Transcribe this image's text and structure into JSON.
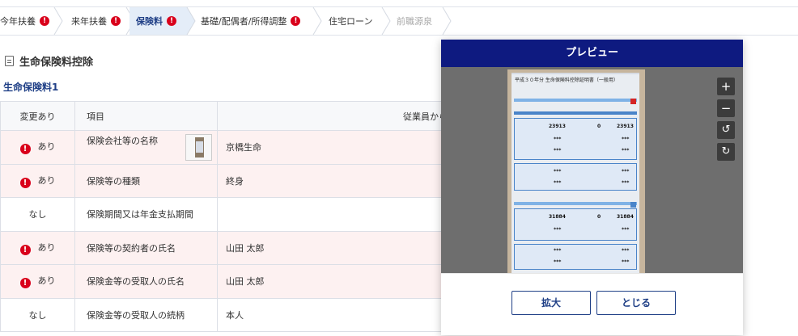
{
  "steps": [
    {
      "label": "今年扶養",
      "alert": "!",
      "state": "normal"
    },
    {
      "label": "来年扶養",
      "alert": "!",
      "state": "normal"
    },
    {
      "label": "保険料",
      "alert": "!",
      "state": "active"
    },
    {
      "label": "基礎/配偶者/所得調整",
      "alert": "!",
      "state": "normal"
    },
    {
      "label": "住宅ローン",
      "alert": "",
      "state": "normal"
    },
    {
      "label": "前職源泉",
      "alert": "",
      "state": "disabled"
    }
  ],
  "section": {
    "title": "生命保険料控除",
    "subtitle": "生命保険料1"
  },
  "table": {
    "headers": {
      "changed": "変更あり",
      "item": "項目",
      "info": "従業員から提出された情報"
    },
    "rows": [
      {
        "changed": "あり",
        "alert": true,
        "item": "保険会社等の名称",
        "value": "京橋生命",
        "thumbnail": true
      },
      {
        "changed": "あり",
        "alert": true,
        "item": "保険等の種類",
        "value": "終身",
        "thumbnail": false
      },
      {
        "changed": "なし",
        "alert": false,
        "item": "保険期間又は年金支払期間",
        "value": "",
        "thumbnail": false
      },
      {
        "changed": "あり",
        "alert": true,
        "item": "保険等の契約者の氏名",
        "value": "山田 太郎",
        "thumbnail": false
      },
      {
        "changed": "あり",
        "alert": true,
        "item": "保険金等の受取人の氏名",
        "value": "山田 太郎",
        "thumbnail": false
      },
      {
        "changed": "なし",
        "alert": false,
        "item": "保険金等の受取人の続柄",
        "value": "本人",
        "thumbnail": false
      }
    ]
  },
  "preview": {
    "title": "プレビュー",
    "document": {
      "heading": "平成３０年分 生命保険料控除証明書（一般用）",
      "amount_1": "23913",
      "amount_1_b": "0",
      "amount_1_c": "23913",
      "amount_2": "31884",
      "amount_2_b": "0",
      "amount_2_c": "31884",
      "masked": "***"
    },
    "zoom_in_icon": "+",
    "zoom_out_icon": "−",
    "rotate_left_icon": "↺",
    "rotate_right_icon": "↻",
    "enlarge_label": "拡大",
    "close_label": "とじる"
  },
  "colors": {
    "accent": "#1f3f86",
    "modal_header": "#0e1a80",
    "alert": "#d9001b",
    "row_highlight": "#fdf1f1",
    "info_border": "#77b05f"
  }
}
